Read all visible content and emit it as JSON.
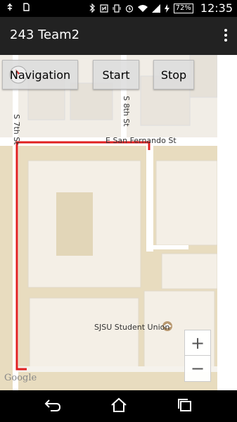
{
  "status_bar": {
    "time": "12:35",
    "battery": "72%",
    "left_icons": [
      "usb-icon",
      "sd-card-icon"
    ],
    "right_icons": [
      "bluetooth-icon",
      "nfc-icon",
      "vibrate-icon",
      "alarm-icon",
      "wifi-icon",
      "signal-icon",
      "charging-icon"
    ]
  },
  "app_bar": {
    "title": "243 Team2"
  },
  "buttons": {
    "navigation": "Navigation",
    "start": "Start",
    "stop": "Stop"
  },
  "map": {
    "streets": {
      "s7th": "S 7th St",
      "s8th": "S 8th St",
      "san_fernando": "E San Fernando St"
    },
    "poi": "SJSU Student Union",
    "attribution": "Google",
    "route_color": "#e02020",
    "road_color": "#ffffff",
    "building_color": "#f4efe6",
    "ground_color": "#e8dcbf"
  },
  "zoom": {
    "in": "+",
    "out": "−"
  }
}
